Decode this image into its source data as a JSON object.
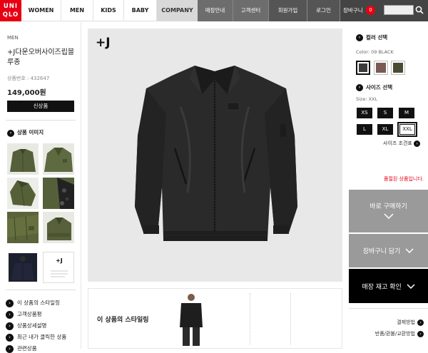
{
  "brand": {
    "line1": "UNI",
    "line2": "QLO"
  },
  "nav": {
    "women": "WOMEN",
    "men": "MEN",
    "kids": "KIDS",
    "baby": "BABY",
    "company": "COMPANY",
    "store_info": "매장안내",
    "customer_center": "고객센터",
    "join": "회원가입",
    "login": "로그인",
    "cart": "장바구니",
    "cart_count": "0"
  },
  "product": {
    "category": "MEN",
    "name": "+J다운오버사이즈립블루종",
    "code": "상품번호 : 432647",
    "price": "149,000원",
    "new_label": "신상품"
  },
  "left_sidebar": {
    "images_title": "상품 이미지",
    "links": [
      "이 상품의 스타일링",
      "고객상품평",
      "상품상세설명",
      "최근 내가 클릭한 상품",
      "관련상품"
    ]
  },
  "main": {
    "logo_mark": "+J",
    "styling_title": "이 상품의 스타일링"
  },
  "options": {
    "color_title": "컬러 선택",
    "color_value": "Color: 09 BLACK",
    "colors": [
      "#3b3b3b",
      "#7a5a52",
      "#4a4b33"
    ],
    "size_title": "사이즈 선택",
    "size_value": "Size: XXL",
    "sizes": [
      "XS",
      "S",
      "M",
      "L",
      "XL",
      "XXL"
    ],
    "size_guide": "사이즈 조견표",
    "soldout": "품절된 상품입니다."
  },
  "actions": {
    "buy_now": "바로 구매하기",
    "add_cart": "장바구니 담기",
    "check_stock": "매장 재고 확인",
    "payment": "결제방법",
    "returns": "반품/환불/교환방법"
  }
}
